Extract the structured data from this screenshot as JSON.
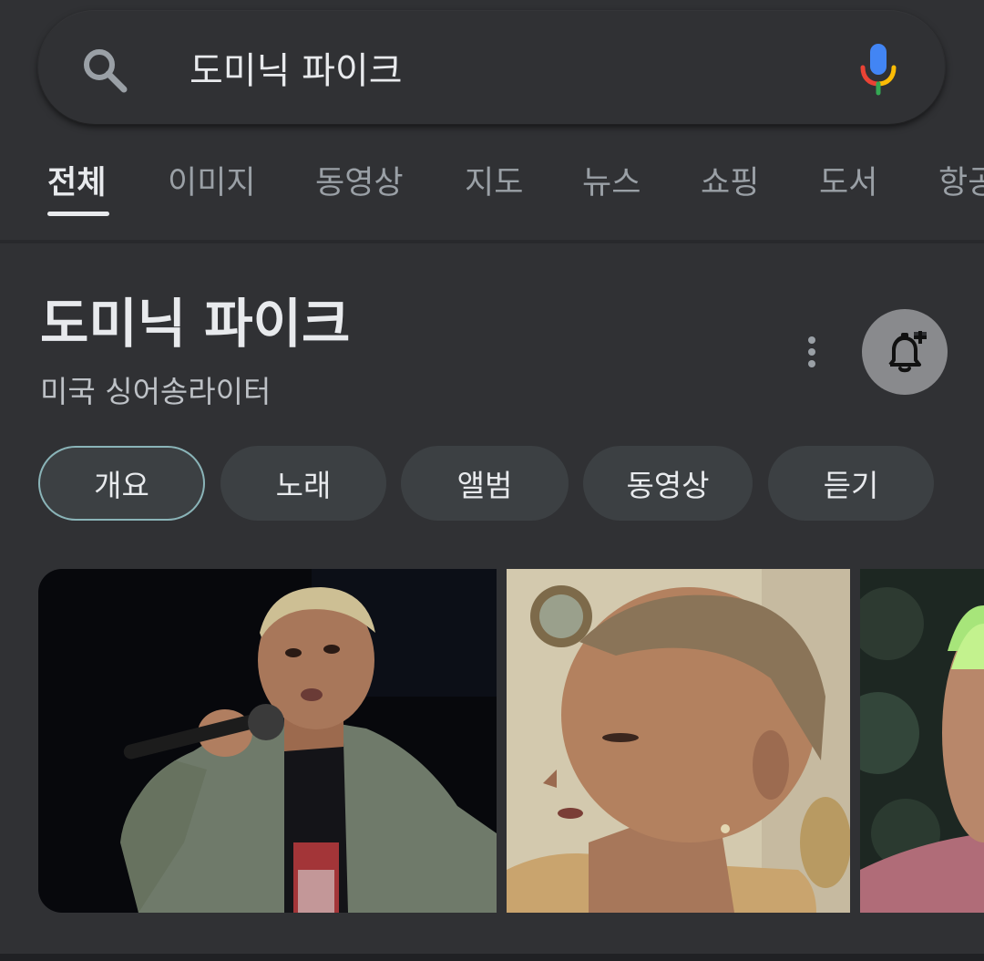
{
  "search": {
    "query": "도미닉 파이크"
  },
  "tabs": [
    "전체",
    "이미지",
    "동영상",
    "지도",
    "뉴스",
    "쇼핑",
    "도서",
    "항공"
  ],
  "active_tab": "전체",
  "panel": {
    "title": "도미닉 파이크",
    "subtitle": "미국 싱어송라이터",
    "chips": [
      "개요",
      "노래",
      "앨범",
      "동영상",
      "듣기"
    ],
    "selected_chip": "개요"
  },
  "icons": {
    "search": "search-icon",
    "mic": "mic-icon",
    "more": "more-vert-icon",
    "bell": "bell-plus-icon"
  },
  "colors": {
    "background": "#303134",
    "text": "#e8eaed",
    "muted": "#9aa0a6",
    "chip": "#3c4043",
    "mic_blue": "#4285f4",
    "mic_red": "#ea4335",
    "mic_yellow": "#fbbc05",
    "mic_green": "#34a853"
  }
}
